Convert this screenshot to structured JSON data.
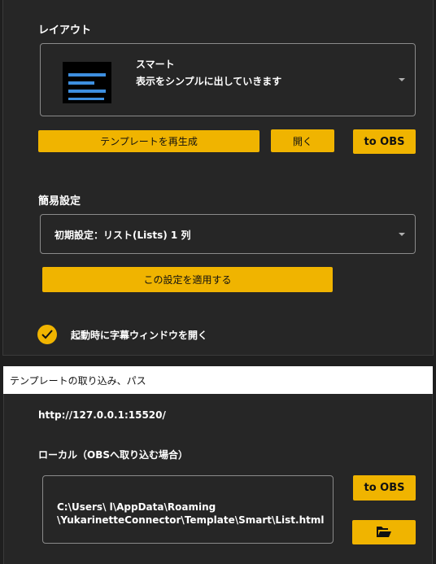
{
  "layout_section": {
    "label": "レイアウト",
    "dropdown": {
      "title": "スマート",
      "description": "表示をシンプルに出していきます",
      "thumbnail_icon": "list-layout-thumbnail-icon"
    },
    "buttons": {
      "regenerate": "テンプレートを再生成",
      "open": "開く",
      "to_obs": "to OBS"
    }
  },
  "quick_settings": {
    "label": "簡易設定",
    "selected": "初期設定：リスト(Lists) 1 列",
    "apply_button": "この設定を適用する"
  },
  "startup_option": {
    "label": "起動時に字幕ウィンドウを開く",
    "checked": true
  },
  "template_import": {
    "header": "テンプレートの取り込み、パス",
    "url": "http://127.0.0.1:15520/",
    "local_label": "ローカル（OBSへ取り込む場合）",
    "path_line1": "C:\\Users\\          l\\AppData\\Roaming",
    "path_line2": "\\YukarinetteConnector\\Template\\Smart\\List.html",
    "to_obs": "to OBS",
    "folder_icon": "folder-open-icon"
  },
  "colors": {
    "accent": "#f0b400",
    "background": "#1f1f1f",
    "panel": "#262626",
    "thumbnail_bar": "#3d8fe0"
  }
}
